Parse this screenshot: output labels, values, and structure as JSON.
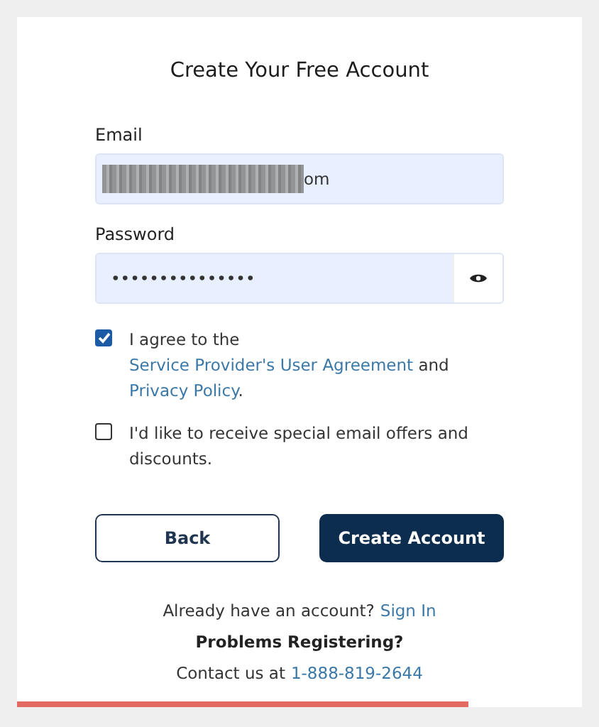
{
  "title": "Create Your Free Account",
  "fields": [
    {
      "label": "Email",
      "value": "om",
      "redacted": true
    },
    {
      "label": "Password",
      "value": "•••••••••••••••",
      "reveal": true
    }
  ],
  "checkboxes": [
    {
      "checked": true,
      "parts": [
        {
          "kind": "text",
          "text": "I agree to the "
        },
        {
          "kind": "link",
          "text": "Service Provider's User "
        },
        {
          "kind": "link",
          "text": "Agreement"
        },
        {
          "kind": "text",
          "text": " and "
        },
        {
          "kind": "link",
          "text": "Privacy Policy"
        },
        {
          "kind": "text",
          "text": "."
        }
      ]
    },
    {
      "checked": false,
      "parts": [
        {
          "kind": "text",
          "text": "I'd like to receive special email offers and discounts."
        }
      ]
    }
  ],
  "buttons": [
    {
      "label": "Back",
      "kind": "secondary"
    },
    {
      "label": "Create Account",
      "kind": "primary"
    }
  ],
  "signin": {
    "text": "Already have an account?",
    "link": "Sign In"
  },
  "problems": "Problems Registering?",
  "contact": {
    "text": "Contact us at",
    "link": "1-888-819-2644"
  }
}
